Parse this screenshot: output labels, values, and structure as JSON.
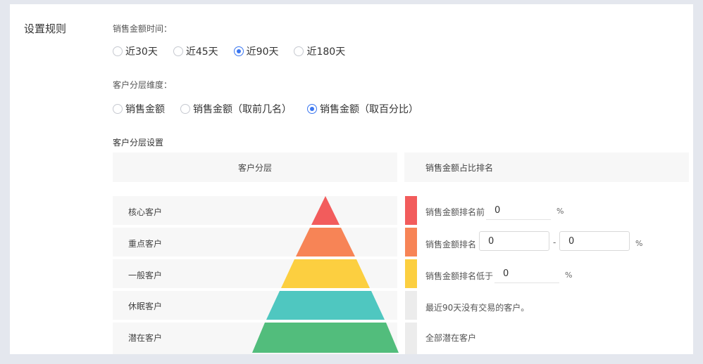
{
  "section_title": "设置规则",
  "time_label": "销售金额时间：",
  "time_options": [
    {
      "label": "近30天",
      "checked": false
    },
    {
      "label": "近45天",
      "checked": false
    },
    {
      "label": "近90天",
      "checked": true
    },
    {
      "label": "近180天",
      "checked": false
    }
  ],
  "dimension_label": "客户分层维度：",
  "dimension_options": [
    {
      "label": "销售金额",
      "checked": false
    },
    {
      "label": "销售金额（取前几名）",
      "checked": false
    },
    {
      "label": "销售金额（取百分比）",
      "checked": true
    }
  ],
  "tier_settings_title": "客户分层设置",
  "table": {
    "col_tier": "客户分层",
    "col_rank": "销售金额占比排名"
  },
  "tiers": [
    {
      "name": "核心客户",
      "color": "#f25c5c",
      "rank_text": "销售金额排名前",
      "value1": "0",
      "unit": "%"
    },
    {
      "name": "重点客户",
      "color": "#f78456",
      "rank_text": "销售金额排名",
      "value1": "0",
      "dash": "-",
      "value2": "0",
      "unit": "%"
    },
    {
      "name": "一般客户",
      "color": "#fccf40",
      "rank_text": "销售金额排名低于",
      "value1": "0",
      "unit": "%"
    },
    {
      "name": "休眠客户",
      "color": "#4fc7c0",
      "rank_text": "最近90天没有交易的客户。"
    },
    {
      "name": "潜在客户",
      "color": "#52bd7c",
      "rank_text": "全部潜在客户"
    }
  ],
  "swatch_inactive": "#ececec"
}
